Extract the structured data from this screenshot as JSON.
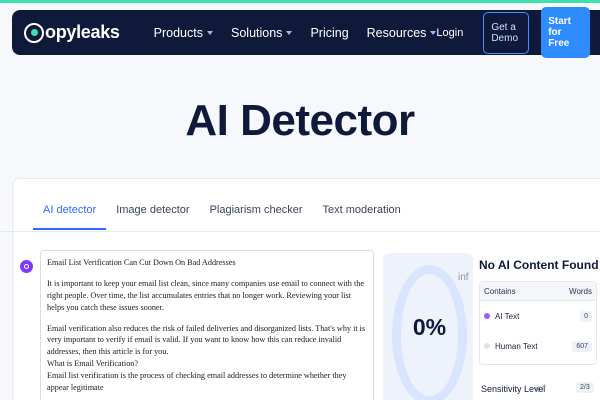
{
  "brand": {
    "logo_text": "opyleaks",
    "accent": "#3fe0b0"
  },
  "nav": {
    "items": [
      {
        "label": "Products",
        "dropdown": true
      },
      {
        "label": "Solutions",
        "dropdown": true
      },
      {
        "label": "Pricing",
        "dropdown": false
      },
      {
        "label": "Resources",
        "dropdown": true
      }
    ],
    "login": "Login",
    "demo": "Get a Demo",
    "start": "Start for Free"
  },
  "hero": {
    "title": "AI Detector"
  },
  "tabs": [
    "AI detector",
    "Image detector",
    "Plagiarism checker",
    "Text moderation"
  ],
  "active_tab": "AI detector",
  "editor": {
    "heading": "Email List Verification Can Cut Down On Bad Addresses",
    "p1": "It is important to keep your email list clean, since many companies use email to connect with the right people. Over time, the list accumulates entries that no longer work. Reviewing your list helps you catch these issues sooner.",
    "p2": "Email verification also reduces the risk of failed deliveries and disorganized lists. That's why it is very important to verify if email is valid. If you want to know how this can reduce invalid addresses, then this article is for you.",
    "p3": "What is Email Verification?",
    "p4": "Email list verification is the process of checking email addresses to determine whether they appear legitimate"
  },
  "result": {
    "gauge_value": "0%",
    "inf_label": "inf",
    "title": "No AI Content Found",
    "col_contains": "Contains",
    "col_words": "Words",
    "rows": [
      {
        "label": "AI Text",
        "count": "0",
        "color": "#9b5cff"
      },
      {
        "label": "Human Text",
        "count": "607",
        "color": "#dfe4ee"
      }
    ],
    "sensitivity_label": "Sensitivity Level",
    "sensitivity_value": "2/3"
  }
}
